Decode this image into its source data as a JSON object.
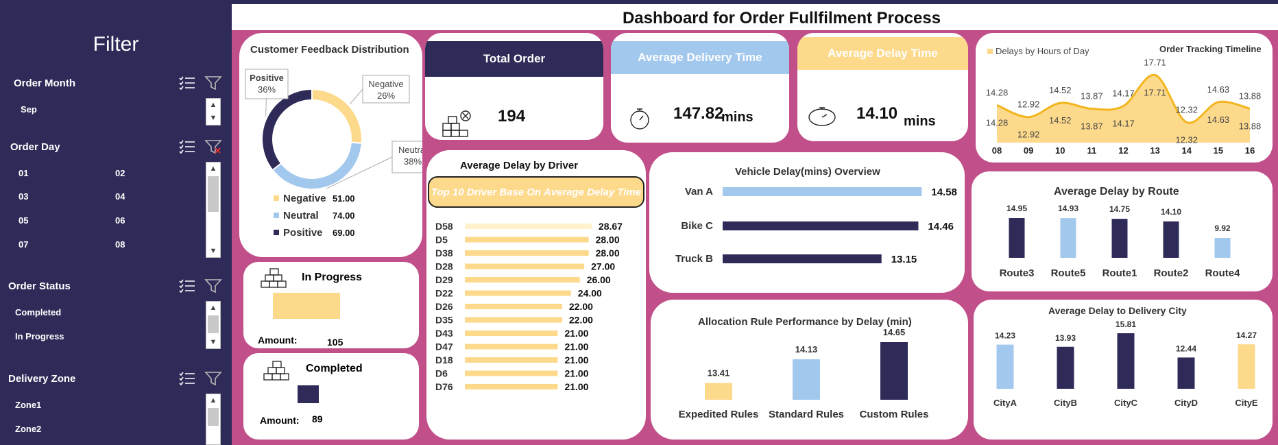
{
  "header": {
    "title": "Dashboard for Order Fullfilment Process"
  },
  "sidebar": {
    "title": "Filter",
    "slicers": [
      {
        "name": "Order Month",
        "items": [
          "Sep"
        ]
      },
      {
        "name": "Order Day",
        "items": [
          "01",
          "02",
          "03",
          "04",
          "05",
          "06",
          "07",
          "08"
        ]
      },
      {
        "name": "Order Status",
        "items": [
          "Completed",
          "In Progress"
        ]
      },
      {
        "name": "Delivery Zone",
        "items": [
          "Zone1",
          "Zone2"
        ]
      }
    ]
  },
  "kpis": {
    "total_order": {
      "label": "Total Order",
      "value": "194"
    },
    "avg_delivery": {
      "label": "Average Delivery Time",
      "value": "147.82",
      "unit": "mins"
    },
    "avg_delay": {
      "label": "Average Delay Time",
      "value": "14.10",
      "unit": "mins"
    }
  },
  "status_cards": {
    "in_progress": {
      "label": "In Progress",
      "amount_label": "Amount:",
      "amount": "105",
      "fraction": 1.0
    },
    "completed": {
      "label": "Completed",
      "amount_label": "Amount:",
      "amount": "89",
      "fraction": 0.32
    }
  },
  "colors": {
    "navy": "#2f2b58",
    "light_blue": "#a3c8ee",
    "yellow": "#fdd98c",
    "pink": "#c1508a"
  },
  "chart_data": [
    {
      "id": "feedback",
      "type": "pie",
      "title": "Customer Feedback Distribution",
      "categories": [
        "Negative",
        "Neutral",
        "Positive"
      ],
      "values": [
        51,
        74,
        69
      ],
      "value_labels": [
        "51.00",
        "74.00",
        "69.00"
      ],
      "percent_labels": [
        "26%",
        "38%",
        "36%"
      ],
      "colors": [
        "#fdd98c",
        "#a3c8ee",
        "#2f2b58"
      ],
      "legend": "bottom"
    },
    {
      "id": "hourly",
      "type": "area",
      "title": "Order Tracking Timeline",
      "series": [
        {
          "name": "Delays by Hours of Day",
          "values": [
            14.28,
            12.92,
            14.52,
            13.87,
            14.17,
            17.71,
            12.32,
            14.63,
            13.88
          ]
        }
      ],
      "x": [
        "08",
        "09",
        "10",
        "11",
        "12",
        "13",
        "14",
        "15",
        "16"
      ],
      "value_labels": [
        "14.28",
        "12.92",
        "14.52",
        "13.87",
        "14.17",
        "17.71",
        "12.32",
        "14.63",
        "13.88"
      ],
      "legend": "top-left"
    },
    {
      "id": "driver",
      "type": "bar",
      "title": "Average Delay by Driver",
      "subtitle": "Top 10 Driver Base On Average Delay Time",
      "categories": [
        "D58",
        "D5",
        "D38",
        "D28",
        "D29",
        "D22",
        "D26",
        "D35",
        "D43",
        "D47",
        "D18",
        "D6",
        "D76"
      ],
      "values": [
        28.67,
        28.0,
        28.0,
        27.0,
        26.0,
        24.0,
        22.0,
        22.0,
        21.0,
        21.0,
        21.0,
        21.0,
        21.0
      ],
      "value_labels": [
        "28.67",
        "28.00",
        "28.00",
        "27.00",
        "26.00",
        "24.00",
        "22.00",
        "22.00",
        "21.00",
        "21.00",
        "21.00",
        "21.00",
        "21.00"
      ]
    },
    {
      "id": "vehicle",
      "type": "bar",
      "title": "Vehicle Delay(mins) Overview",
      "categories": [
        "Van A",
        "Bike C",
        "Truck B"
      ],
      "values": [
        14.58,
        14.46,
        13.15
      ],
      "value_labels": [
        "14.58",
        "14.46",
        "13.15"
      ],
      "colors": [
        "#a3c8ee",
        "#2f2b58",
        "#2f2b58"
      ]
    },
    {
      "id": "allocation",
      "type": "bar",
      "title": "Allocation Rule Performance by Delay (min)",
      "categories": [
        "Expedited Rules",
        "Standard Rules",
        "Custom Rules"
      ],
      "values": [
        13.41,
        14.13,
        14.65
      ],
      "value_labels": [
        "13.41",
        "14.13",
        "14.65"
      ],
      "colors": [
        "#fdd98c",
        "#a3c8ee",
        "#2f2b58"
      ]
    },
    {
      "id": "route",
      "type": "bar",
      "title": "Average Delay by Route",
      "categories": [
        "Route3",
        "Route5",
        "Route1",
        "Route2",
        "Route4"
      ],
      "values": [
        14.95,
        14.93,
        14.75,
        14.1,
        9.92
      ],
      "value_labels": [
        "14.95",
        "14.93",
        "14.75",
        "14.10",
        "9.92"
      ],
      "colors": [
        "#2f2b58",
        "#a3c8ee",
        "#2f2b58",
        "#2f2b58",
        "#a3c8ee"
      ]
    },
    {
      "id": "city",
      "type": "bar",
      "title": "Average Delay to Delivery City",
      "categories": [
        "CityA",
        "CityB",
        "CityC",
        "CityD",
        "CityE"
      ],
      "values": [
        14.23,
        13.93,
        15.81,
        12.44,
        14.27
      ],
      "value_labels": [
        "14.23",
        "13.93",
        "15.81",
        "12.44",
        "14.27"
      ],
      "colors": [
        "#a3c8ee",
        "#2f2b58",
        "#2f2b58",
        "#2f2b58",
        "#fdd98c"
      ]
    }
  ]
}
